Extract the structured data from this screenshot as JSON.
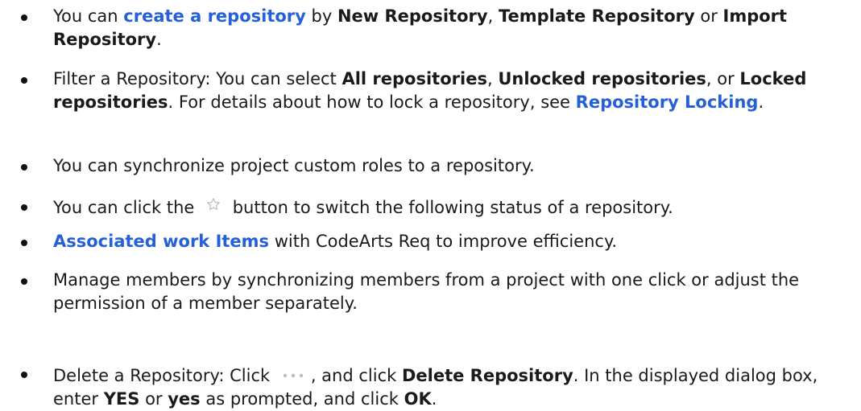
{
  "items": [
    {
      "segments": [
        {
          "t": "You can "
        },
        {
          "t": "create a repository",
          "link": true
        },
        {
          "t": " by "
        },
        {
          "t": "New Repository",
          "b": true
        },
        {
          "t": ", "
        },
        {
          "t": "Template Repository",
          "b": true
        },
        {
          "t": " or "
        },
        {
          "t": "Import Repository",
          "b": true
        },
        {
          "t": "."
        }
      ]
    },
    {
      "segments": [
        {
          "t": "Filter a Repository: You can select "
        },
        {
          "t": "All repositories",
          "b": true
        },
        {
          "t": ", "
        },
        {
          "t": "Unlocked repositories",
          "b": true
        },
        {
          "t": ", or "
        },
        {
          "t": "Locked repositories",
          "b": true
        },
        {
          "t": ". For details about how to lock a repository, see "
        },
        {
          "t": "Repository Locking",
          "link": true
        },
        {
          "t": "."
        }
      ]
    },
    {
      "segments": [
        {
          "t": "You can synchronize project custom roles to a repository."
        }
      ]
    },
    {
      "segments": [
        {
          "t": "You can click the "
        },
        {
          "icon": "star-icon"
        },
        {
          "t": " button to switch the following status of a repository."
        }
      ]
    },
    {
      "segments": [
        {
          "t": "Associated work Items",
          "link": true
        },
        {
          "t": " with CodeArts Req to improve efficiency."
        }
      ]
    },
    {
      "segments": [
        {
          "t": "Manage members by synchronizing members from a project with one click or adjust the permission of a member separately."
        }
      ]
    },
    {
      "segments": [
        {
          "t": "Delete a Repository: Click "
        },
        {
          "icon": "more-icon"
        },
        {
          "t": ", and click "
        },
        {
          "t": "Delete Repository",
          "b": true
        },
        {
          "t": ". In the displayed dialog box, enter "
        },
        {
          "t": "YES",
          "b": true
        },
        {
          "t": " or "
        },
        {
          "t": "yes",
          "b": true
        },
        {
          "t": " as prompted, and click "
        },
        {
          "t": "OK",
          "b": true
        },
        {
          "t": "."
        }
      ]
    }
  ],
  "colors": {
    "link": "#2560d8",
    "text": "#1a1a1a",
    "icon": "#b8bcc4"
  }
}
